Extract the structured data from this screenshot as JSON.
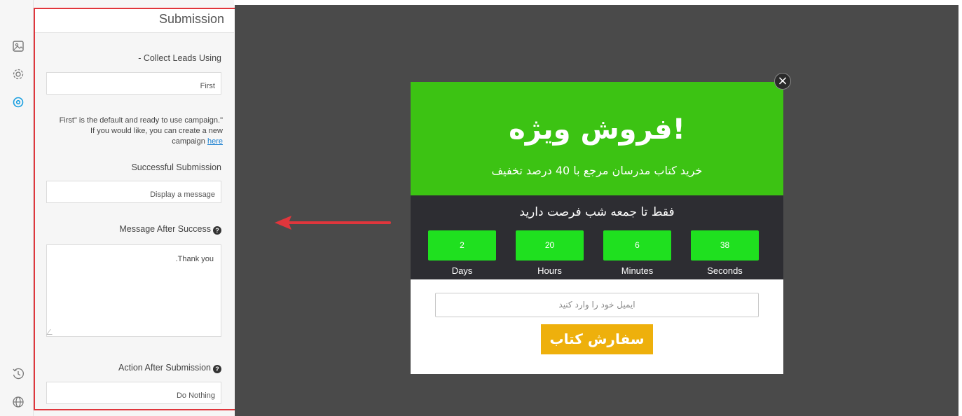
{
  "sidebar_icons": [
    "image-icon",
    "gear-icon",
    "target-icon",
    "history-icon",
    "globe-icon"
  ],
  "panel": {
    "title": "Submission",
    "collect_label": "- Collect Leads Using",
    "collect_value": "First",
    "help_line1": "First\" is the default and ready to use campaign.\"",
    "help_line2": "If you would like, you can create a new",
    "help_line3": "campaign",
    "help_link": "here",
    "success_label": "Successful Submission",
    "success_value": "Display a message",
    "message_label": "Message After Success",
    "message_value": ".Thank you",
    "action_label": "Action After Submission",
    "action_value": "Do Nothing"
  },
  "popup": {
    "title": "!فروش ویژه",
    "subtitle": "خرید کتاب مدرسان مرجع با 40 درصد تخفیف",
    "timer_title": "فقط تا جمعه شب فرصت دارید",
    "countdown": [
      {
        "value": "2",
        "label": "Days"
      },
      {
        "value": "20",
        "label": "Hours"
      },
      {
        "value": "6",
        "label": "Minutes"
      },
      {
        "value": "38",
        "label": "Seconds"
      }
    ],
    "email_placeholder": "ایمیل خود را وارد کنید",
    "button_label": "سفارش کتاب",
    "close_glyph": "×"
  },
  "colors": {
    "hero_bg": "#3cc313",
    "timer_bg": "#2d2d32",
    "countdown_box": "#1fe01f",
    "button_bg": "#eeb00c",
    "highlight_red": "#e0363c",
    "accent_blue": "#1a9fe0"
  }
}
